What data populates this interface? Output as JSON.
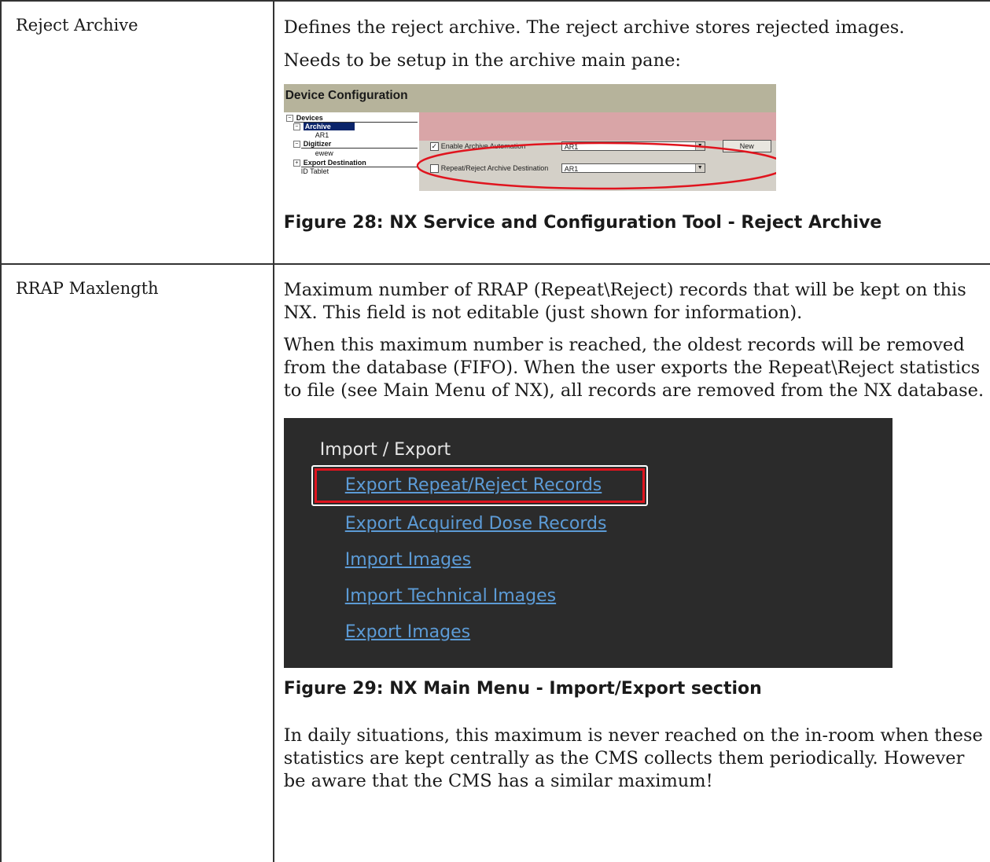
{
  "rows": [
    {
      "name": "Reject Archive",
      "paragraphs": [
        "Defines the reject archive. The reject archive stores rejected images.",
        "Needs to be setup in the archive main pane:"
      ],
      "figure_caption": "Figure 28: NX Service and Configuration Tool - Reject Archive"
    },
    {
      "name": "RRAP Maxlength",
      "paragraphs": [
        "Maximum number of RRAP (Repeat\\Reject) records that will be kept on this NX. This field is not editable (just shown for information).",
        "When this maximum number is reached, the oldest records will be removed from the database (FIFO). When the user exports the Repeat\\Reject statistics to file (see Main Menu of NX), all records are removed from the NX database.",
        "In daily situations, this maximum is never reached on the in-room when these statistics are kept centrally as the CMS collects them periodically. However be aware that the CMS has a similar maximum!"
      ],
      "figure_caption": "Figure 29: NX Main Menu - Import/Export section"
    }
  ],
  "device_config": {
    "title": "Device Configuration",
    "tree": {
      "devices": "Devices",
      "archive": "Archive",
      "ar1": "AR1",
      "digitizer": "Digitizer",
      "ewew": "ewew",
      "export_destination": "Export Destination",
      "id_tablet": "ID Tablet"
    },
    "enable_archive_automation": {
      "label": "Enable Archive Automation",
      "checked": true,
      "value": "AR1"
    },
    "repeat_reject_destination": {
      "label": "Repeat/Reject Archive Destination",
      "checked": false,
      "value": "AR1"
    },
    "new_button": "New",
    "highlight_color": "#e0141e"
  },
  "import_export_menu": {
    "title": "Import / Export",
    "links": [
      "Export Repeat/Reject Records",
      "Export Acquired Dose Records",
      "Import Images",
      "Import Technical Images",
      "Export Images"
    ],
    "highlighted_link": "Export Repeat/Reject Records",
    "link_color": "#5c9bd6",
    "highlight_color": "#e0141e"
  }
}
